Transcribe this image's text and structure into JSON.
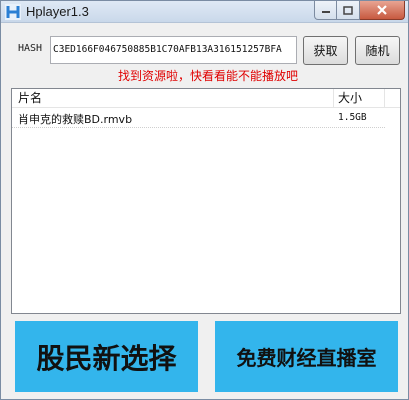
{
  "window": {
    "title": "Hplayer1.3",
    "icon": "hplayer-app-icon",
    "controls": [
      "minimize-icon",
      "maximize-icon",
      "close-icon"
    ]
  },
  "hash": {
    "label": "HASH",
    "value": "C3ED166F046750885B1C70AFB13A316151257BFA"
  },
  "buttons": {
    "fetch": "获取",
    "random": "随机"
  },
  "status": {
    "text": "找到资源啦，快看看能不能播放吧",
    "color": "#e00000"
  },
  "list": {
    "columns": [
      "片名",
      "大小"
    ],
    "rows": [
      {
        "name": "肖申克的救赎BD.rmvb",
        "size": "1.5GB"
      }
    ]
  },
  "banners": {
    "left": "股民新选择",
    "right": "免费财经直播室",
    "color": "#33b5ec"
  }
}
